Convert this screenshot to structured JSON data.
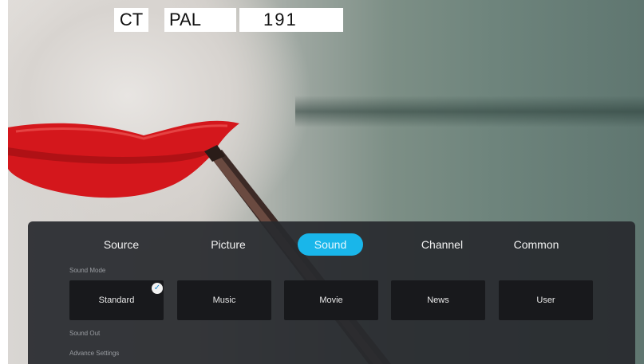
{
  "osd": {
    "source_code": "CT",
    "system": "PAL",
    "channel_number": "191"
  },
  "tabs": [
    {
      "label": "Source",
      "active": false
    },
    {
      "label": "Picture",
      "active": false
    },
    {
      "label": "Sound",
      "active": true
    },
    {
      "label": "Channel",
      "active": false
    },
    {
      "label": "Common",
      "active": false
    }
  ],
  "sound_mode": {
    "label": "Sound Mode",
    "options": [
      "Standard",
      "Music",
      "Movie",
      "News",
      "User"
    ],
    "selected": "Standard"
  },
  "sound_out": {
    "label": "Sound Out"
  },
  "advance_settings": {
    "label": "Advance Settings"
  },
  "colors": {
    "accent": "#19b6ea",
    "panel_bg": "#282a2e",
    "tile_bg": "#18191c",
    "lip_red": "#d4171c"
  },
  "icons": {
    "selected_mark": "check-circle-icon"
  }
}
